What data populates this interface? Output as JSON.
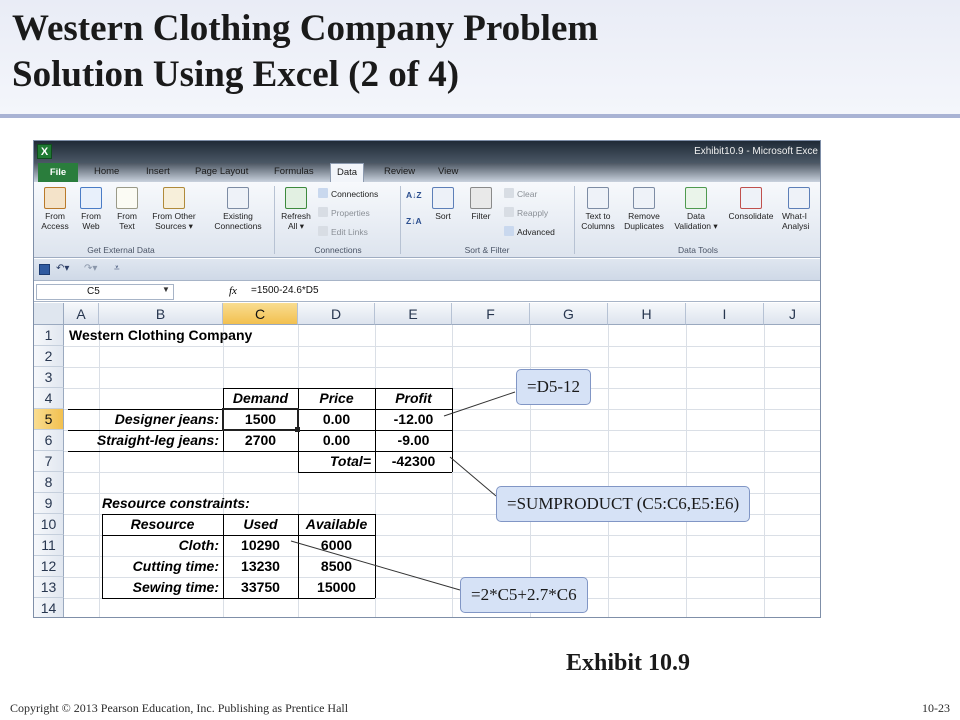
{
  "slide": {
    "title_line1": "Western Clothing Company Problem",
    "title_line2": "Solution Using Excel (2 of  4)",
    "exhibit": "Exhibit 10.9",
    "copyright": "Copyright © 2013 Pearson Education, Inc. Publishing as Prentice Hall",
    "page_number": "10-23"
  },
  "excel": {
    "window_title": "Exhibit10.9  -  Microsoft Exce",
    "logo": "X",
    "tabs": [
      "File",
      "Home",
      "Insert",
      "Page Layout",
      "Formulas",
      "Data",
      "Review",
      "View"
    ],
    "active_tab": "Data",
    "ribbon": {
      "get_external_data": {
        "label": "Get External Data",
        "buttons": [
          {
            "line1": "From",
            "line2": "Access"
          },
          {
            "line1": "From",
            "line2": "Web"
          },
          {
            "line1": "From",
            "line2": "Text"
          },
          {
            "line1": "From Other",
            "line2": "Sources ▾"
          }
        ]
      },
      "existing_connections": {
        "line1": "Existing",
        "line2": "Connections"
      },
      "connections": {
        "label": "Connections",
        "refresh": {
          "line1": "Refresh",
          "line2": "All ▾"
        },
        "items": [
          "Connections",
          "Properties",
          "Edit Links"
        ]
      },
      "sort_filter": {
        "label": "Sort & Filter",
        "sort": "Sort",
        "filter": "Filter",
        "items": [
          "Clear",
          "Reapply",
          "Advanced"
        ]
      },
      "data_tools": {
        "label": "Data Tools",
        "buttons": [
          {
            "line1": "Text to",
            "line2": "Columns"
          },
          {
            "line1": "Remove",
            "line2": "Duplicates"
          },
          {
            "line1": "Data",
            "line2": "Validation ▾"
          },
          {
            "line1": "Consolidate",
            "line2": ""
          },
          {
            "line1": "What-I",
            "line2": "Analysi"
          }
        ]
      }
    },
    "name_box": "C5",
    "fx_label": "fx",
    "formula": "=1500-24.6*D5",
    "columns": [
      "A",
      "B",
      "C",
      "D",
      "E",
      "F",
      "G",
      "H",
      "I",
      "J"
    ],
    "rows": [
      "1",
      "2",
      "3",
      "4",
      "5",
      "6",
      "7",
      "8",
      "9",
      "10",
      "11",
      "12",
      "13",
      "14"
    ],
    "selected_cell": {
      "column": "C",
      "row": "5"
    },
    "sheet": {
      "company": "Western Clothing Company",
      "headers": {
        "demand": "Demand",
        "price": "Price",
        "profit": "Profit"
      },
      "designer_label": "Designer jeans:",
      "designer": {
        "demand": "1500",
        "price": "0.00",
        "profit": "-12.00"
      },
      "straight_label": "Straight-leg jeans:",
      "straight": {
        "demand": "2700",
        "price": "0.00",
        "profit": "-9.00"
      },
      "total_label": "Total=",
      "total_value": "-42300",
      "resource_title": "Resource constraints:",
      "resource_headers": {
        "resource": "Resource",
        "used": "Used",
        "available": "Available"
      },
      "resources": [
        {
          "name": "Cloth:",
          "used": "10290",
          "available": "6000"
        },
        {
          "name": "Cutting time:",
          "used": "13230",
          "available": "8500"
        },
        {
          "name": "Sewing time:",
          "used": "33750",
          "available": "15000"
        }
      ]
    }
  },
  "callouts": {
    "profit_formula": "=D5-12",
    "total_formula": "=SUMPRODUCT (C5:C6,E5:E6)",
    "cloth_formula": "=2*C5+2.7*C6"
  }
}
